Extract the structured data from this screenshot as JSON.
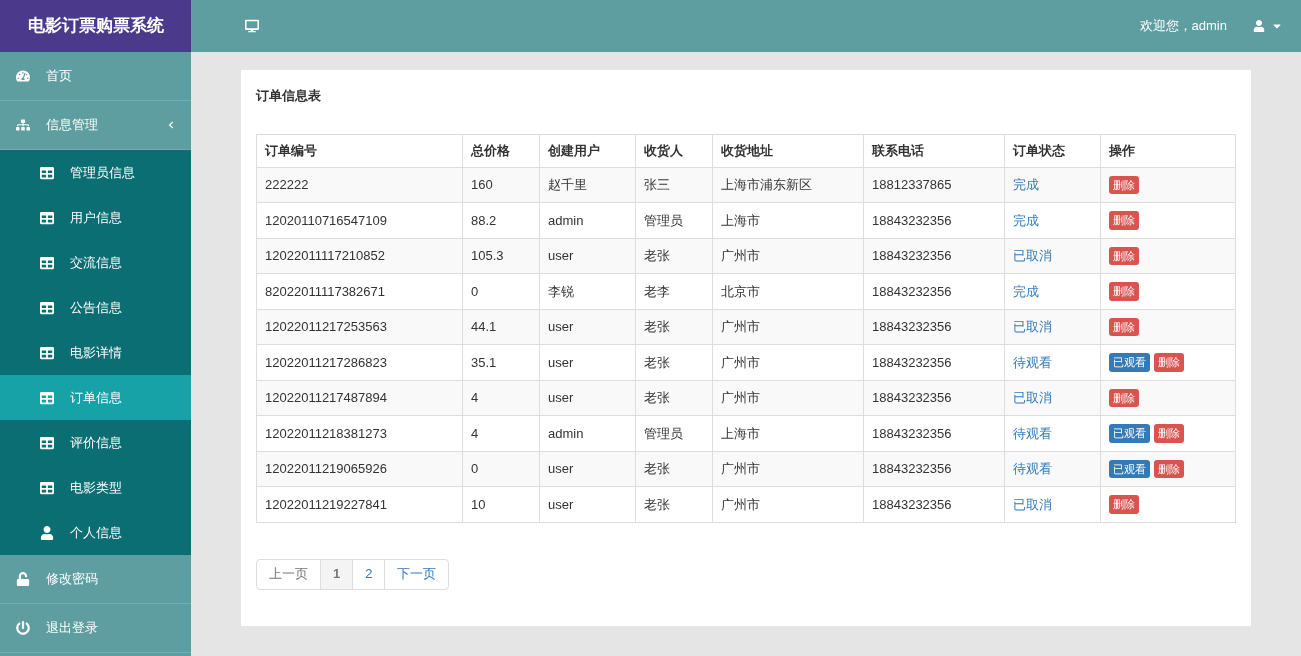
{
  "app_title": "电影订票购票系统",
  "header": {
    "greeting": "欢迎您，admin"
  },
  "sidebar": {
    "items": [
      {
        "label": "首页",
        "selected": false
      },
      {
        "label": "信息管理",
        "selected": false,
        "expanded": true,
        "children": [
          {
            "label": "管理员信息",
            "selected": false
          },
          {
            "label": "用户信息",
            "selected": false
          },
          {
            "label": "交流信息",
            "selected": false
          },
          {
            "label": "公告信息",
            "selected": false
          },
          {
            "label": "电影详情",
            "selected": false
          },
          {
            "label": "订单信息",
            "selected": true
          },
          {
            "label": "评价信息",
            "selected": false
          },
          {
            "label": "电影类型",
            "selected": false
          },
          {
            "label": "个人信息",
            "selected": false
          }
        ]
      },
      {
        "label": "修改密码",
        "selected": false
      },
      {
        "label": "退出登录",
        "selected": false
      }
    ]
  },
  "panel_title": "订单信息表",
  "table": {
    "columns": [
      "订单编号",
      "总价格",
      "创建用户",
      "收货人",
      "收货地址",
      "联系电话",
      "订单状态",
      "操作"
    ],
    "rows": [
      {
        "cells": [
          "222222",
          "160",
          "赵千里",
          "张三",
          "上海市浦东新区",
          "18812337865"
        ],
        "status": "完成",
        "actions": [
          {
            "label": "删除",
            "kind": "danger"
          }
        ]
      },
      {
        "cells": [
          "12020110716547109",
          "88.2",
          "admin",
          "管理员",
          "上海市",
          "18843232356"
        ],
        "status": "完成",
        "actions": [
          {
            "label": "删除",
            "kind": "danger"
          }
        ]
      },
      {
        "cells": [
          "12022011117210852",
          "105.3",
          "user",
          "老张",
          "广州市",
          "18843232356"
        ],
        "status": "已取消",
        "actions": [
          {
            "label": "删除",
            "kind": "danger"
          }
        ]
      },
      {
        "cells": [
          "82022011117382671",
          "0",
          "李锐",
          "老李",
          "北京市",
          "18843232356"
        ],
        "status": "完成",
        "actions": [
          {
            "label": "删除",
            "kind": "danger"
          }
        ]
      },
      {
        "cells": [
          "12022011217253563",
          "44.1",
          "user",
          "老张",
          "广州市",
          "18843232356"
        ],
        "status": "已取消",
        "actions": [
          {
            "label": "删除",
            "kind": "danger"
          }
        ]
      },
      {
        "cells": [
          "12022011217286823",
          "35.1",
          "user",
          "老张",
          "广州市",
          "18843232356"
        ],
        "status": "待观看",
        "actions": [
          {
            "label": "已观看",
            "kind": "primary"
          },
          {
            "label": "删除",
            "kind": "danger"
          }
        ]
      },
      {
        "cells": [
          "12022011217487894",
          "4",
          "user",
          "老张",
          "广州市",
          "18843232356"
        ],
        "status": "已取消",
        "actions": [
          {
            "label": "删除",
            "kind": "danger"
          }
        ]
      },
      {
        "cells": [
          "12022011218381273",
          "4",
          "admin",
          "管理员",
          "上海市",
          "18843232356"
        ],
        "status": "待观看",
        "actions": [
          {
            "label": "已观看",
            "kind": "primary"
          },
          {
            "label": "删除",
            "kind": "danger"
          }
        ]
      },
      {
        "cells": [
          "12022011219065926",
          "0",
          "user",
          "老张",
          "广州市",
          "18843232356"
        ],
        "status": "待观看",
        "actions": [
          {
            "label": "已观看",
            "kind": "primary"
          },
          {
            "label": "删除",
            "kind": "danger"
          }
        ]
      },
      {
        "cells": [
          "12022011219227841",
          "10",
          "user",
          "老张",
          "广州市",
          "18843232356"
        ],
        "status": "已取消",
        "actions": [
          {
            "label": "删除",
            "kind": "danger"
          }
        ]
      }
    ]
  },
  "pagination": [
    {
      "label": "上一页",
      "selected": false,
      "disabled": true
    },
    {
      "label": "1",
      "selected": true,
      "disabled": false
    },
    {
      "label": "2",
      "selected": false,
      "disabled": false
    },
    {
      "label": "下一页",
      "selected": false,
      "disabled": false
    }
  ]
}
